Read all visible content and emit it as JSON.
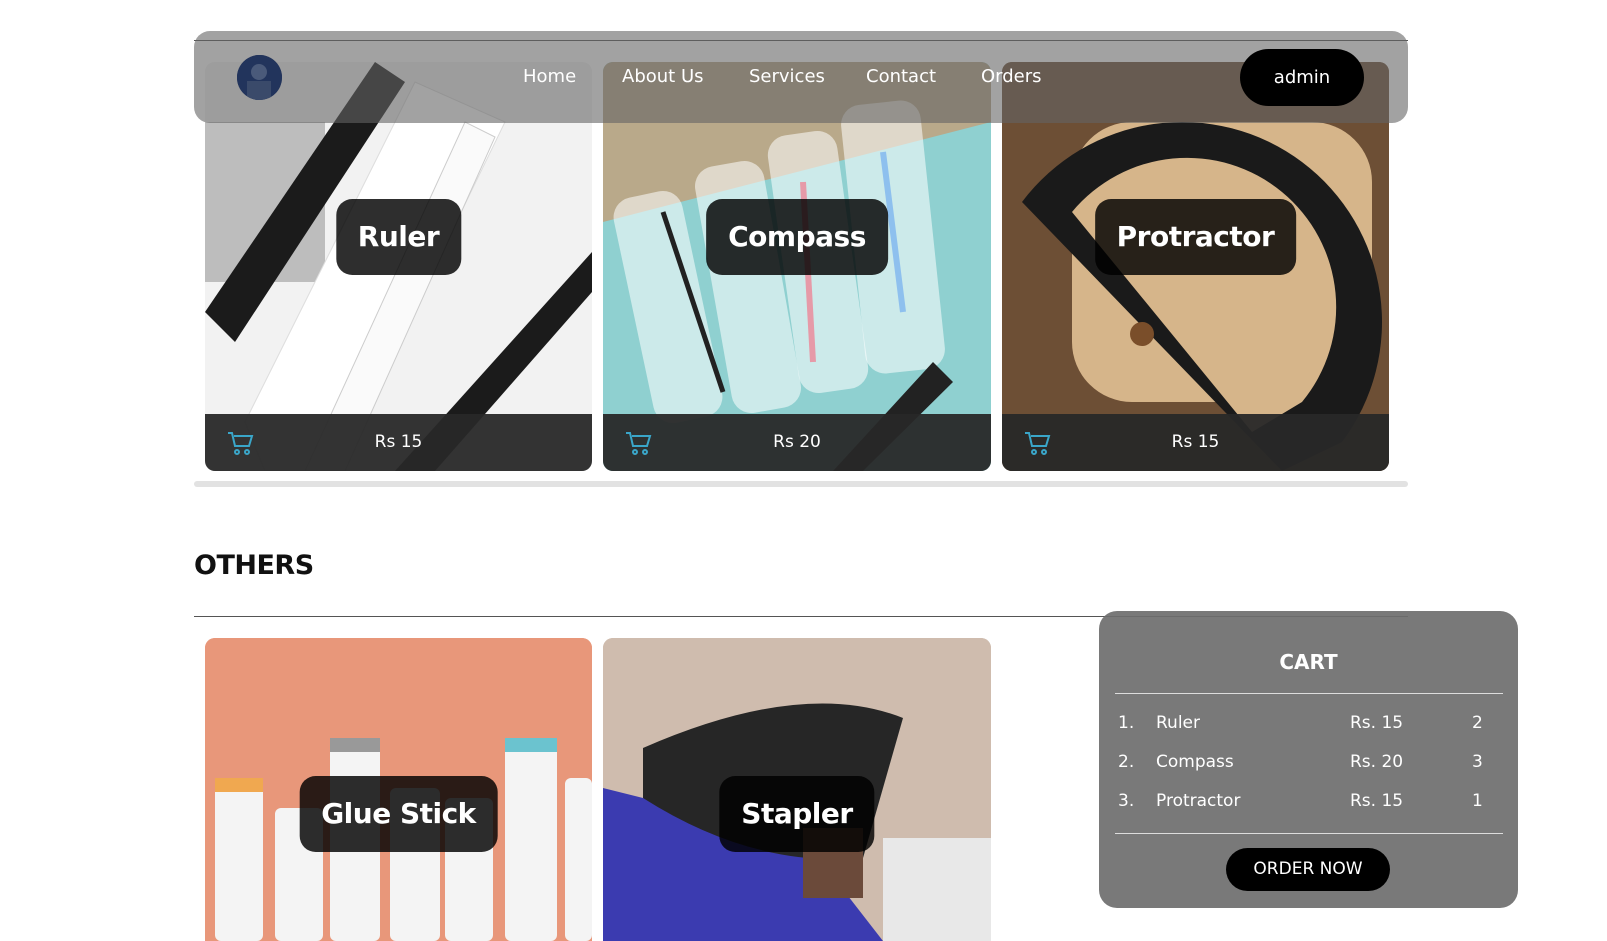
{
  "nav": {
    "links": [
      "Home",
      "About Us",
      "Services",
      "Contact",
      "Orders"
    ],
    "admin_label": "admin"
  },
  "products_top": [
    {
      "name": "Ruler",
      "price": "Rs 15"
    },
    {
      "name": "Compass",
      "price": "Rs 20"
    },
    {
      "name": "Protractor",
      "price": "Rs 15"
    }
  ],
  "section": {
    "title": "OTHERS"
  },
  "products_others": [
    {
      "name": "Glue Stick"
    },
    {
      "name": "Stapler"
    }
  ],
  "cart": {
    "title": "CART",
    "items": [
      {
        "index": "1.",
        "name": "Ruler",
        "price": "Rs. 15",
        "qty": "2"
      },
      {
        "index": "2.",
        "name": "Compass",
        "price": "Rs. 20",
        "qty": "3"
      },
      {
        "index": "3.",
        "name": "Protractor",
        "price": "Rs. 15",
        "qty": "1"
      }
    ],
    "order_label": "ORDER NOW"
  },
  "colors": {
    "cart_icon": "#3aa6c9",
    "nav_bg": "#646464",
    "button_bg": "#000000"
  }
}
